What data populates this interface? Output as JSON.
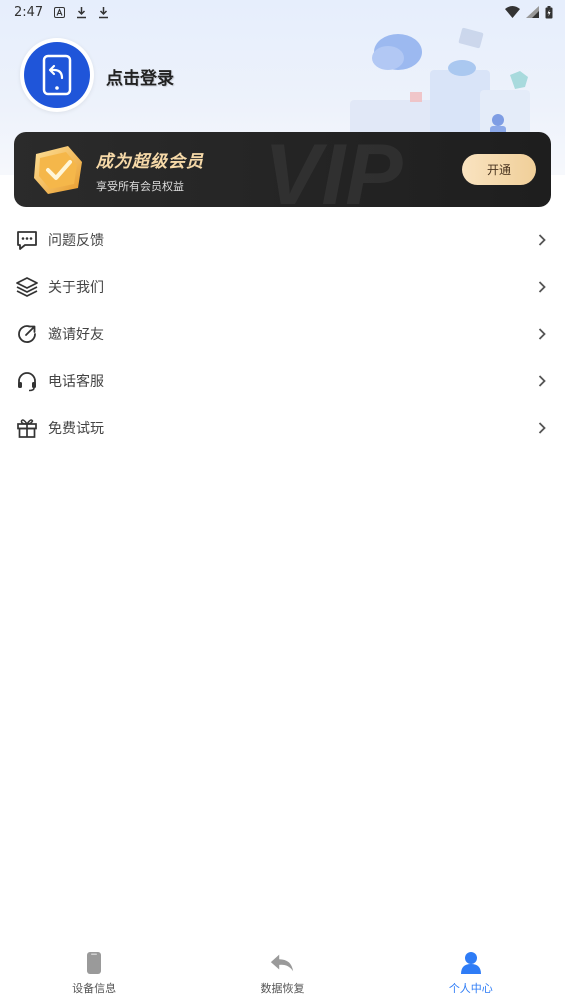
{
  "status_bar": {
    "time": "2:47",
    "icons": [
      "a-icon",
      "download-icon",
      "download-icon"
    ],
    "right_icons": [
      "wifi-icon",
      "signal-icon",
      "battery-icon"
    ]
  },
  "profile": {
    "login_text": "点击登录",
    "avatar_icon": "phone-recover-icon"
  },
  "vip": {
    "title": "成为超级会员",
    "subtitle": "享受所有会员权益",
    "button_label": "开通",
    "watermark": "VIP",
    "accent": "#f0cf99"
  },
  "menu": {
    "items": [
      {
        "label": "问题反馈",
        "icon": "chat-icon"
      },
      {
        "label": "关于我们",
        "icon": "layers-icon"
      },
      {
        "label": "邀请好友",
        "icon": "share-icon"
      },
      {
        "label": "电话客服",
        "icon": "headset-icon"
      },
      {
        "label": "免费试玩",
        "icon": "gift-icon"
      }
    ]
  },
  "bottom_nav": {
    "items": [
      {
        "label": "设备信息",
        "icon": "phone-icon",
        "active": false
      },
      {
        "label": "数据恢复",
        "icon": "undo-arrow-icon",
        "active": false
      },
      {
        "label": "个人中心",
        "icon": "user-icon",
        "active": true
      }
    ],
    "active_color": "#2e7cf6"
  }
}
